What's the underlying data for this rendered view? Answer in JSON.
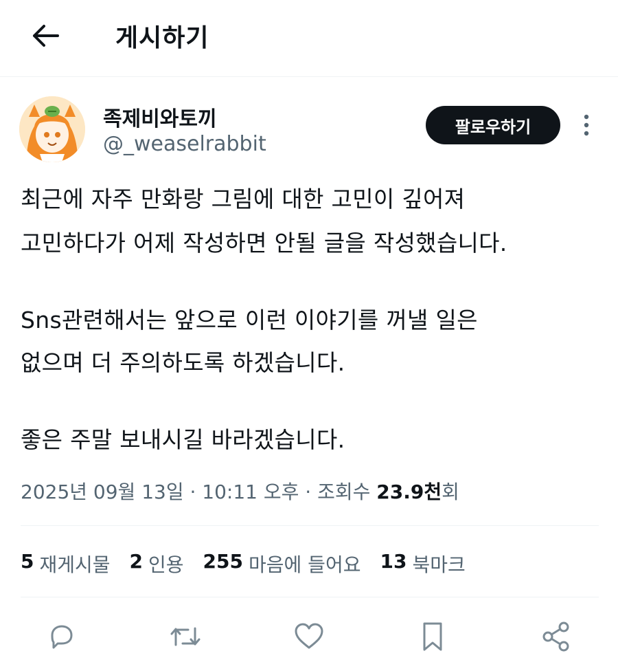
{
  "header": {
    "back_icon": "arrow-left-icon",
    "title": "게시하기"
  },
  "author": {
    "avatar_icon": "avatar-image",
    "name": "족제비와토끼",
    "handle": "@_weaselrabbit",
    "follow_label": "팔로우하기",
    "more_icon": "more-vertical-icon"
  },
  "tweet": {
    "lines": [
      "최근에 자주 만화랑 그림에 대한 고민이 깊어져",
      "고민하다가 어제 작성하면 안될 글을 작성했습니다.",
      "",
      "Sns관련해서는 앞으로 이런 이야기를 꺼낼 일은",
      "없으며 더 주의하도록 하겠습니다.",
      "",
      "좋은 주말 보내시길 바라겠습니다."
    ]
  },
  "meta": {
    "datetime": "2025년 09월 13일 · 10:11 오후 · 조회수 ",
    "views": "23.9천",
    "views_suffix": "회"
  },
  "stats": {
    "retweets": {
      "count": "5",
      "label": "재게시물"
    },
    "quotes": {
      "count": "2",
      "label": "인용"
    },
    "likes": {
      "count": "255",
      "label": "마음에 들어요"
    },
    "bookmarks": {
      "count": "13",
      "label": "북마크"
    }
  },
  "actions": [
    "reply-icon",
    "retweet-icon",
    "heart-icon",
    "bookmark-icon",
    "share-icon"
  ],
  "colors": {
    "text": "#0f1419",
    "secondary": "#536471",
    "divider": "#eff3f4",
    "follow_bg": "#0f1419"
  }
}
